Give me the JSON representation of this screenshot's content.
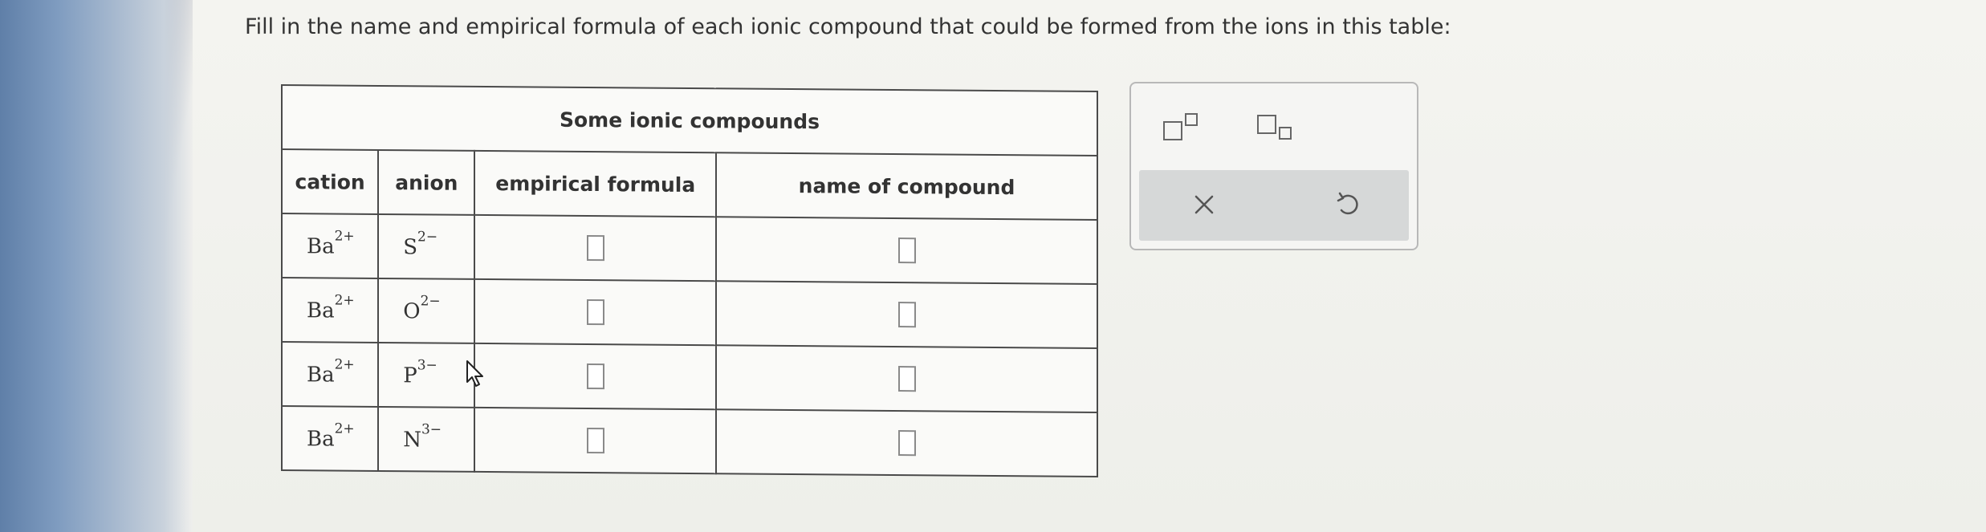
{
  "question": "Fill in the name and empirical formula of each ionic compound that could be formed from the ions in this table:",
  "table": {
    "title": "Some ionic compounds",
    "headers": {
      "cation": "cation",
      "anion": "anion",
      "formula": "empirical formula",
      "name": "name of compound"
    },
    "rows": [
      {
        "cation_symbol": "Ba",
        "cation_charge": "2+",
        "anion_symbol": "S",
        "anion_charge": "2−"
      },
      {
        "cation_symbol": "Ba",
        "cation_charge": "2+",
        "anion_symbol": "O",
        "anion_charge": "2−"
      },
      {
        "cation_symbol": "Ba",
        "cation_charge": "2+",
        "anion_symbol": "P",
        "anion_charge": "3−"
      },
      {
        "cation_symbol": "Ba",
        "cation_charge": "2+",
        "anion_symbol": "N",
        "anion_charge": "3−"
      }
    ]
  },
  "toolbox": {
    "superscript_tool_icon": "superscript-icon",
    "subscript_tool_icon": "subscript-icon",
    "clear_icon": "x-icon",
    "undo_icon": "undo-icon",
    "clear_glyph": "×"
  }
}
